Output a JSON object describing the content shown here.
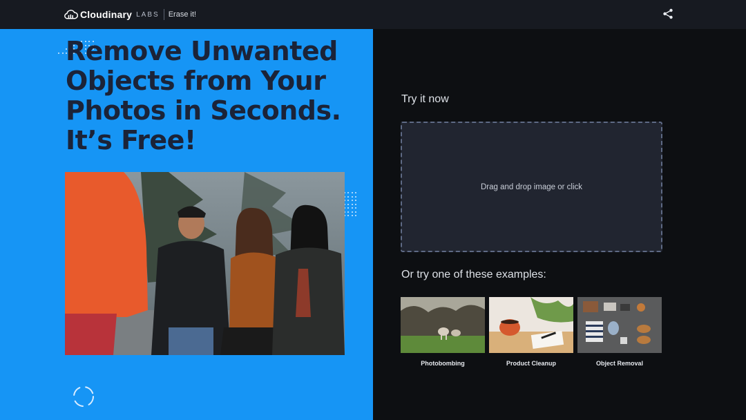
{
  "nav": {
    "brand_name": "Cloudinary",
    "brand_labs": "LABS",
    "product_name": "Erase it!",
    "share_icon": "share-icon"
  },
  "hero": {
    "title": "Remove Unwanted Objects from Your Photos in Seconds. It’s Free!"
  },
  "panel": {
    "try_now": "Try it now",
    "dropzone_text": "Drag and drop image or click",
    "examples_title": "Or try one of these examples:",
    "examples": [
      {
        "label": "Photobombing"
      },
      {
        "label": "Product Cleanup"
      },
      {
        "label": "Object Removal"
      }
    ]
  },
  "colors": {
    "hero_bg": "#1695f5",
    "topbar_bg": "#171a21",
    "panel_bg": "#0d0f12",
    "dropzone_bg": "#212530",
    "dropzone_border": "#5e6a85",
    "title_color": "#1b2338"
  }
}
